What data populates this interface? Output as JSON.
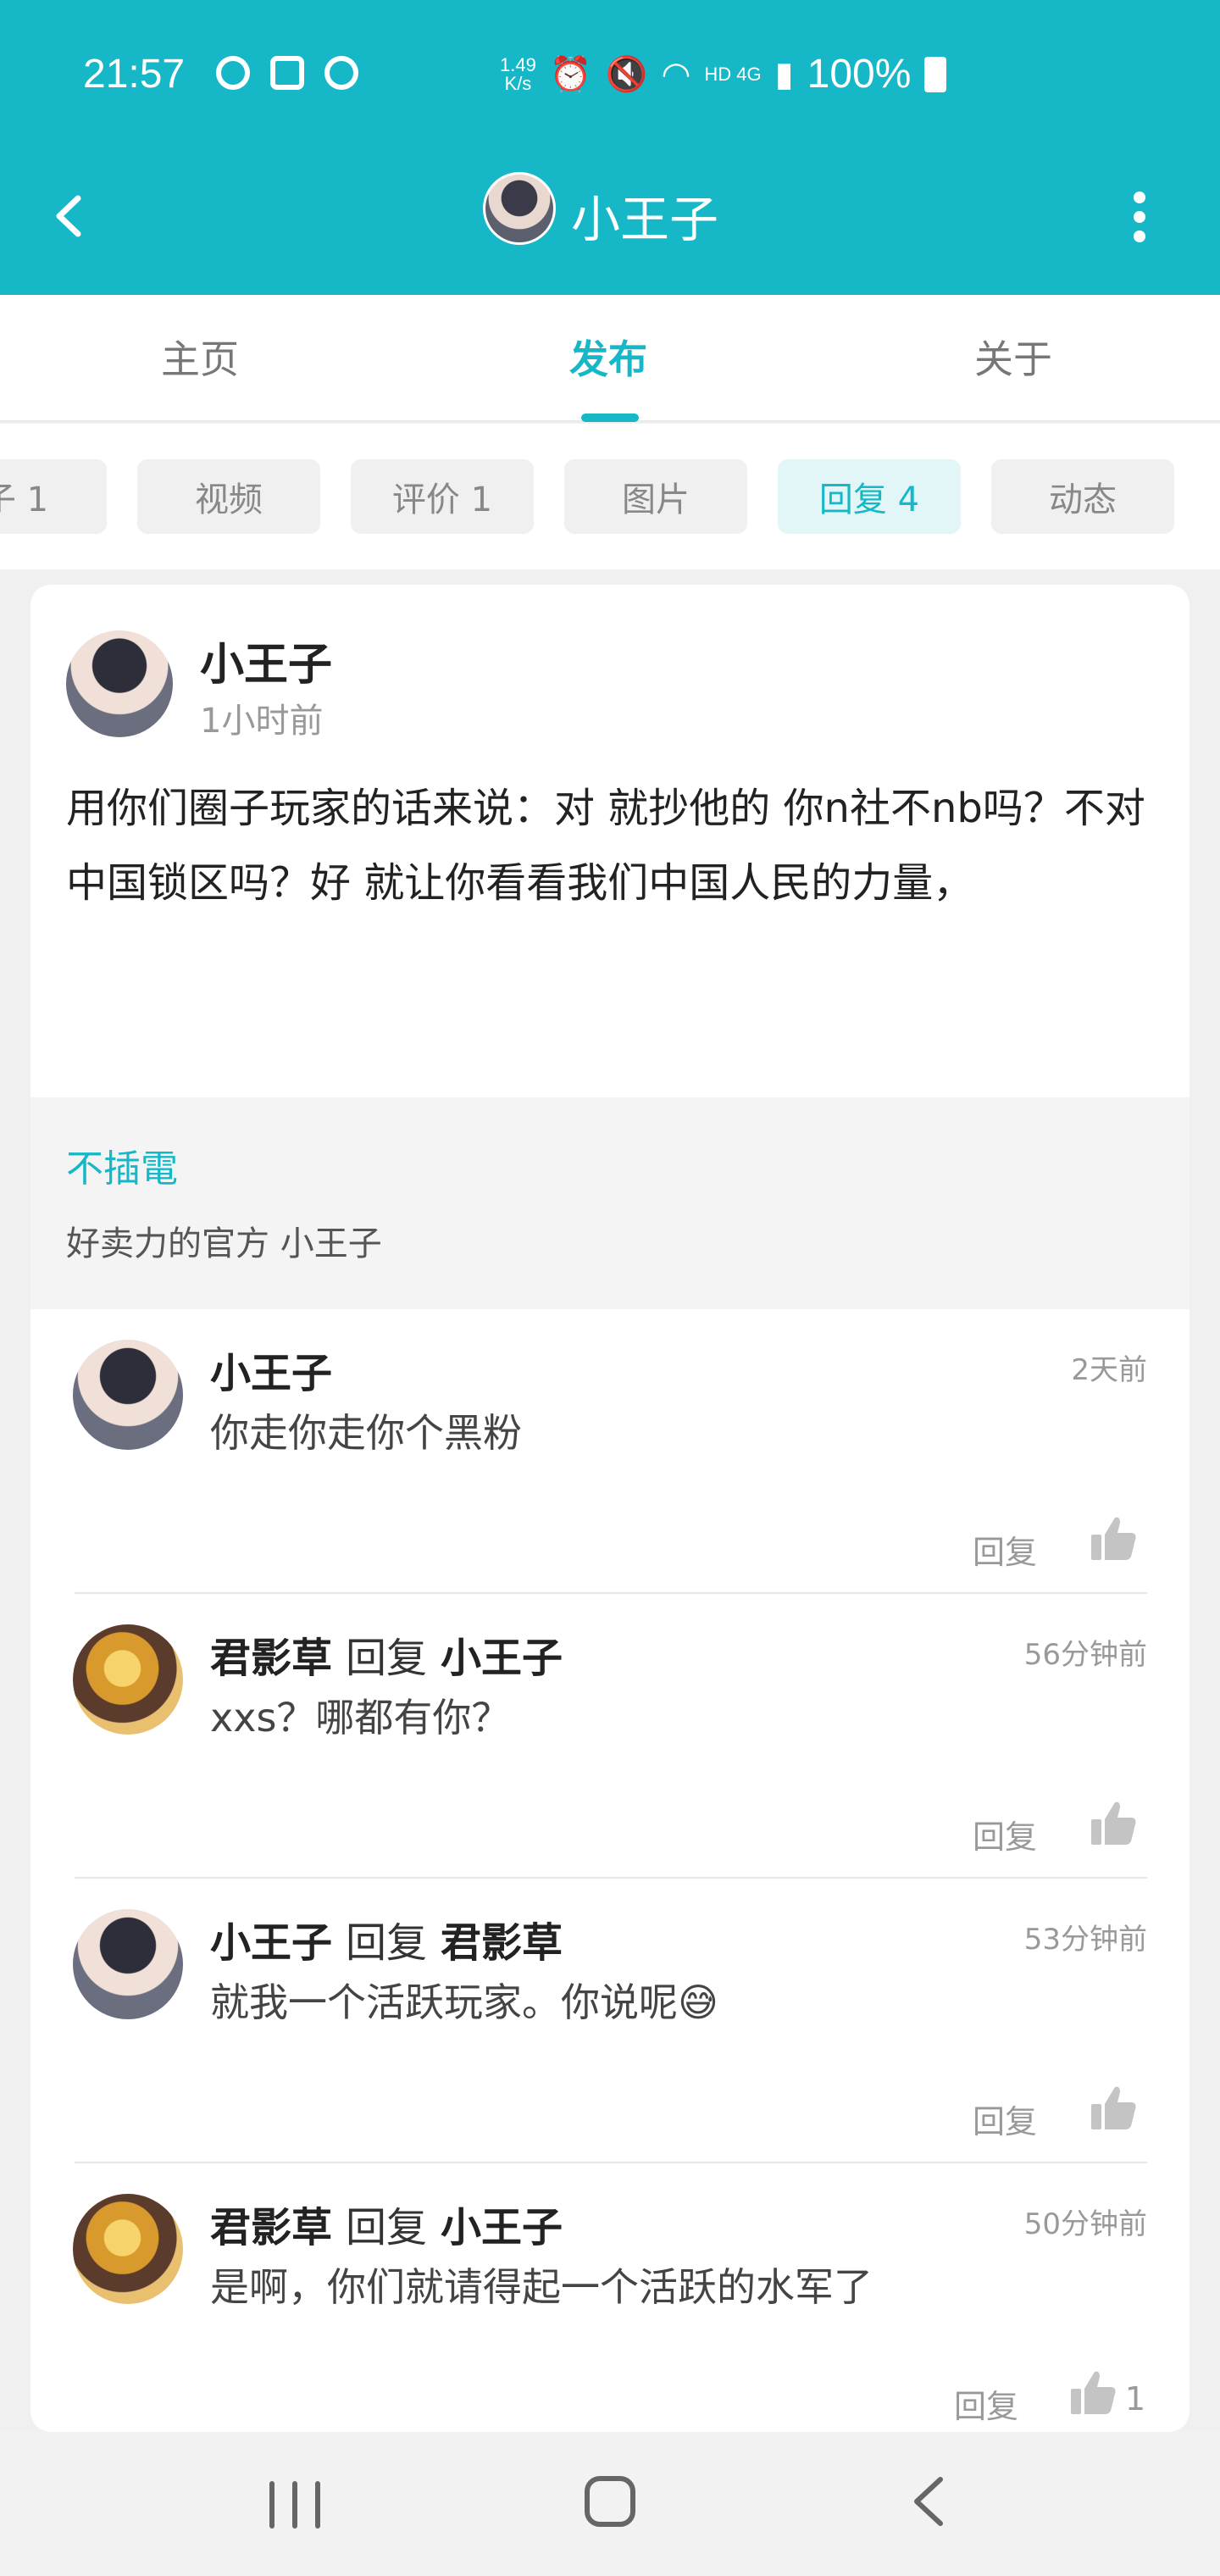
{
  "status_bar": {
    "time": "21:57",
    "speed_top": "1.49",
    "speed_bottom": "K/s",
    "network": "HD 4G",
    "battery": "100%"
  },
  "header": {
    "title": "小王子",
    "back_icon": "chevron-left-icon",
    "more_icon": "more-vertical-icon"
  },
  "tabs": [
    {
      "label": "主页"
    },
    {
      "label": "发布"
    },
    {
      "label": "关于"
    }
  ],
  "filters": [
    {
      "label": "子 1"
    },
    {
      "label": "视频"
    },
    {
      "label": "评价 1"
    },
    {
      "label": "图片"
    },
    {
      "label": "回复 4"
    },
    {
      "label": "动态"
    }
  ],
  "post": {
    "author": "小王子",
    "time": "1小时前",
    "body": "用你们圈子玩家的话来说：对 就抄他的 你n社不nb吗？不对中国锁区吗？好 就让你看看我们中国人民的力量，"
  },
  "reference": {
    "author": "不插電",
    "text": "好卖力的官方 小王子"
  },
  "comments": [
    {
      "author": "小王子",
      "reply_word": "",
      "target": "",
      "time": "2天前",
      "text": "你走你走你个黑粉",
      "reply_label": "回复",
      "likes": ""
    },
    {
      "author": "君影草",
      "reply_word": "回复",
      "target": "小王子",
      "time": "56分钟前",
      "text": "xxs？哪都有你？",
      "reply_label": "回复",
      "likes": ""
    },
    {
      "author": "小王子",
      "reply_word": "回复",
      "target": "君影草",
      "time": "53分钟前",
      "text": "就我一个活跃玩家。你说呢😅",
      "reply_label": "回复",
      "likes": ""
    },
    {
      "author": "君影草",
      "reply_word": "回复",
      "target": "小王子",
      "time": "50分钟前",
      "text": "是啊，你们就请得起一个活跃的水军了",
      "reply_label": "回复",
      "likes": "1"
    }
  ],
  "colors": {
    "accent": "#16b8c8",
    "background": "#f0f0f0"
  }
}
